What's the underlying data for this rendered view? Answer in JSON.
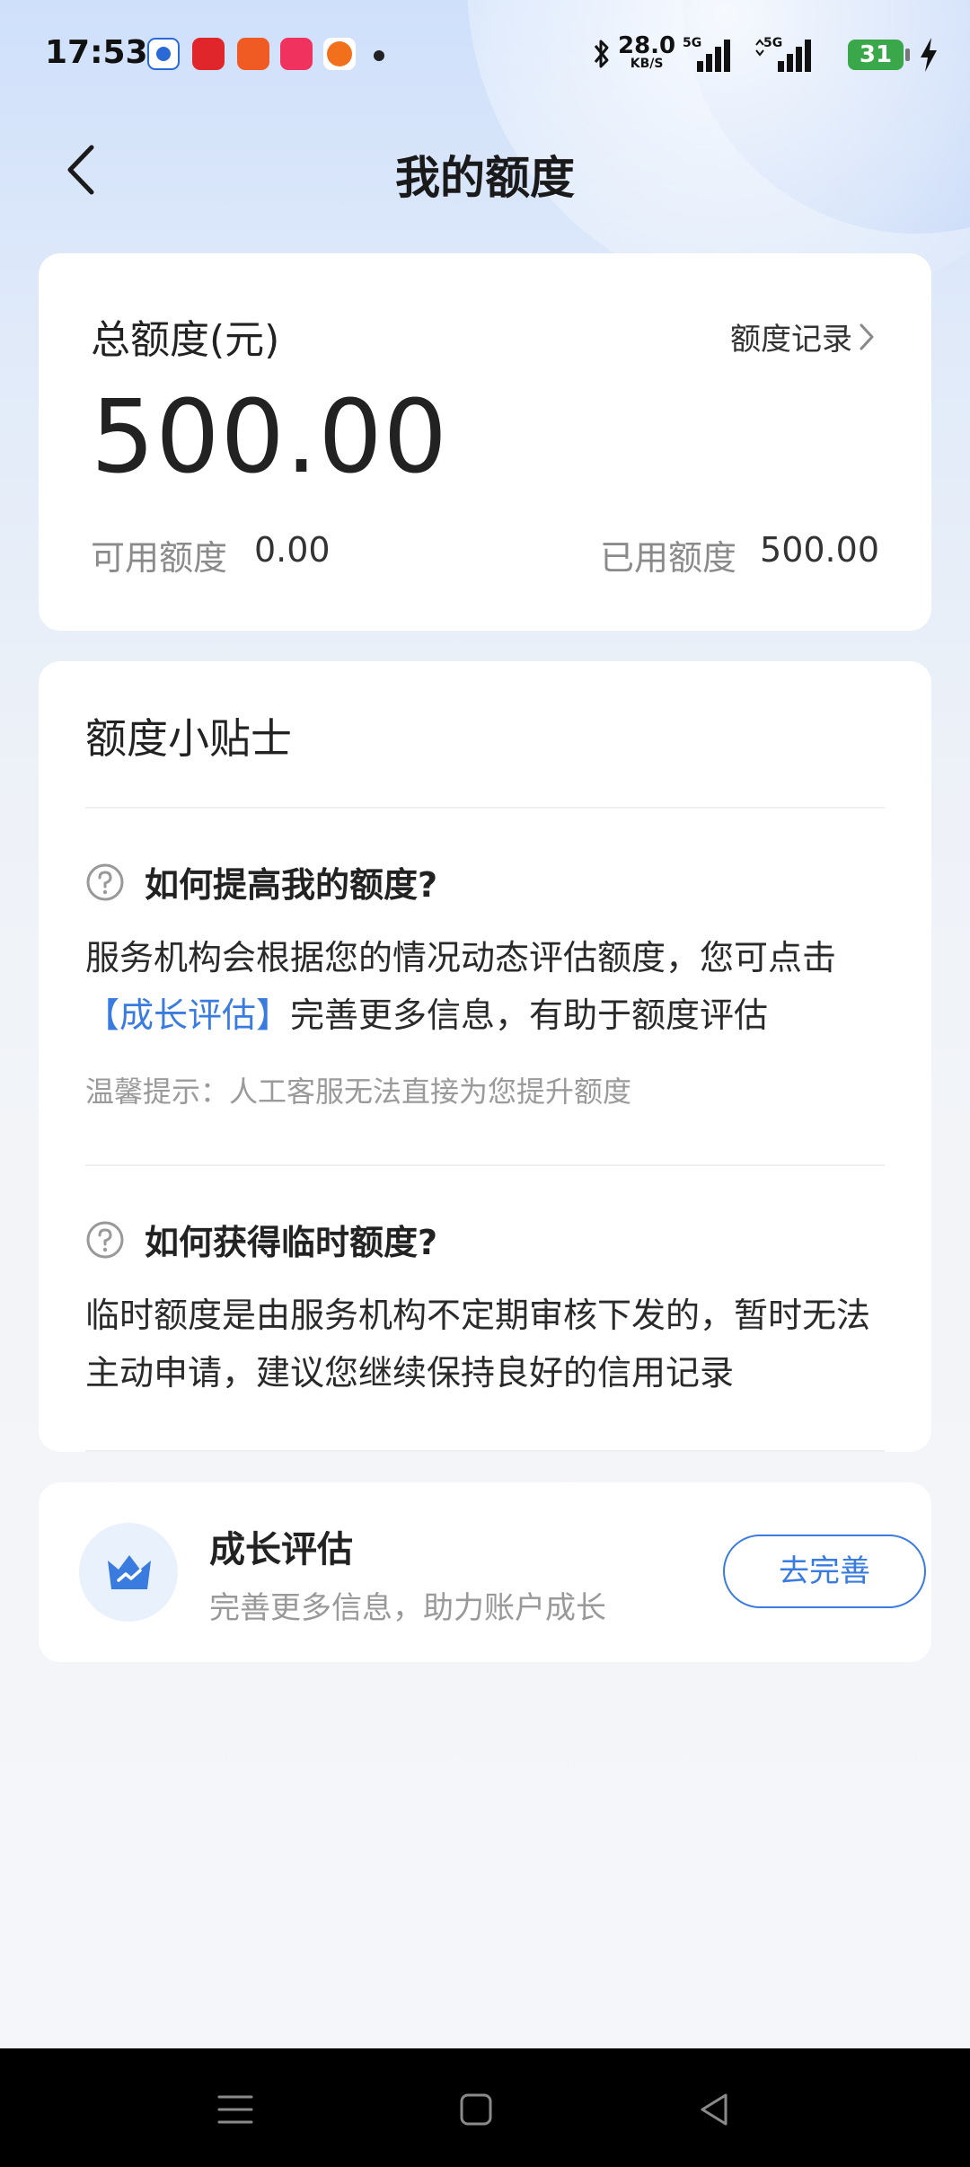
{
  "status_bar": {
    "time": "17:53",
    "network_speed_value": "28.0",
    "network_speed_unit": "KB/S",
    "signal1_label": "5G",
    "signal2_label": "5G",
    "battery_level": "31"
  },
  "header": {
    "title": "我的额度"
  },
  "quota_card": {
    "total_label": "总额度(元)",
    "record_link": "额度记录",
    "total_value": "500.00",
    "available_label": "可用额度",
    "available_value": "0.00",
    "used_label": "已用额度",
    "used_value": "500.00"
  },
  "tips_card": {
    "title": "额度小贴士",
    "q1": {
      "question": "如何提高我的额度?",
      "answer_part1": "服务机构会根据您的情况动态评估额度，您可点击",
      "answer_link": "【成长评估】",
      "answer_part2": "完善更多信息，有助于额度评估",
      "hint": "温馨提示：人工客服无法直接为您提升额度"
    },
    "q2": {
      "question": "如何获得临时额度?",
      "answer": "临时额度是由服务机构不定期审核下发的，暂时无法主动申请，建议您继续保持良好的信用记录"
    }
  },
  "growth_card": {
    "title": "成长评估",
    "subtitle": "完善更多信息，助力账户成长",
    "button_label": "去完善",
    "icon": "growth-crown-icon"
  },
  "colors": {
    "accent": "#3a7be0",
    "battery": "#3aa84a"
  }
}
